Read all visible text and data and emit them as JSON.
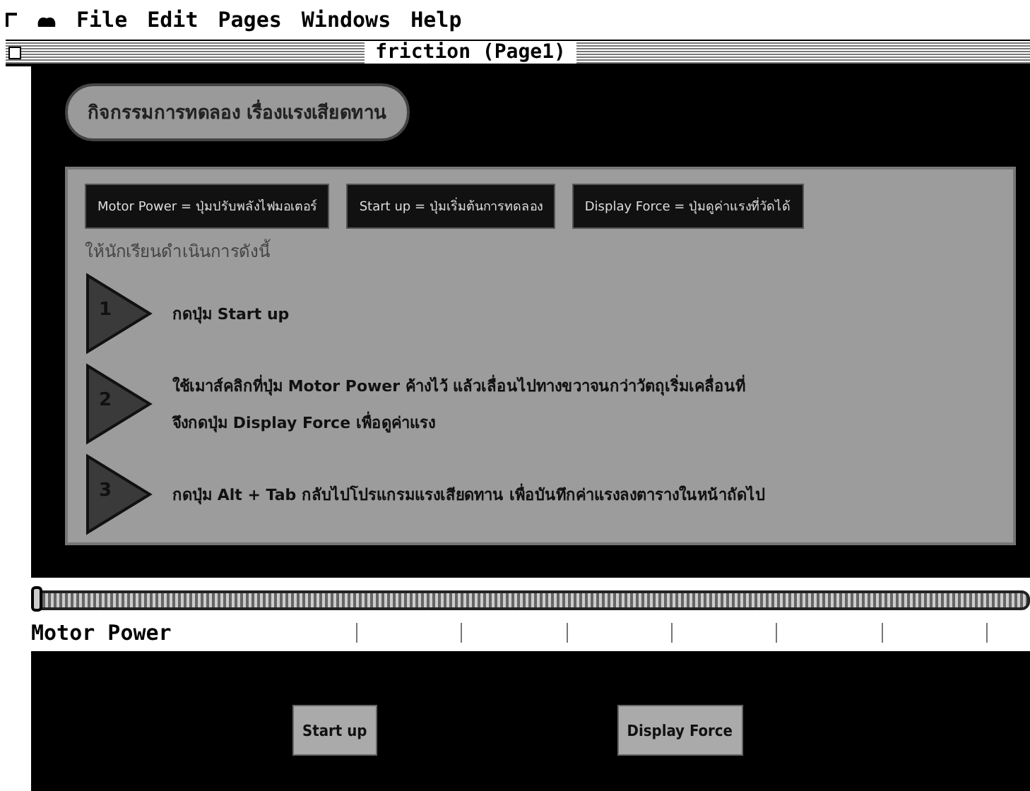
{
  "menu_bar": {
    "items": [
      "File",
      "Edit",
      "Pages",
      "Windows",
      "Help"
    ]
  },
  "window": {
    "title": "friction (Page1)"
  },
  "heading": "กิจกรรมการทดลอง เรื่องแรงเสียดทาน",
  "legend": [
    {
      "label": "Motor Power = ปุ่มปรับพลังไฟมอเตอร์"
    },
    {
      "label": "Start up = ปุ่มเริ่มต้นการทดลอง"
    },
    {
      "label": "Display Force = ปุ่มดูค่าแรงที่วัดได้"
    }
  ],
  "instruction": "ให้นักเรียนดำเนินการดังนี้",
  "steps": [
    {
      "number": "1",
      "lines": [
        "กดปุ่ม Start up"
      ]
    },
    {
      "number": "2",
      "lines": [
        "ใช้เมาส์คลิกที่ปุ่ม Motor Power ค้างไว้ แล้วเลื่อนไปทางขวาจนกว่าวัตถุเริ่มเคลื่อนที่",
        "จึงกดปุ่ม Display Force เพื่อดูค่าแรง"
      ]
    },
    {
      "number": "3",
      "lines": [
        "กดปุ่ม Alt + Tab กลับไปโปรแกรมแรงเสียดทาน เพื่อบันทึกค่าแรงลงตารางในหน้าถัดไป"
      ]
    }
  ],
  "slider": {
    "label": "Motor Power",
    "level": 0
  },
  "buttons": [
    "Start up",
    "Display Force"
  ]
}
